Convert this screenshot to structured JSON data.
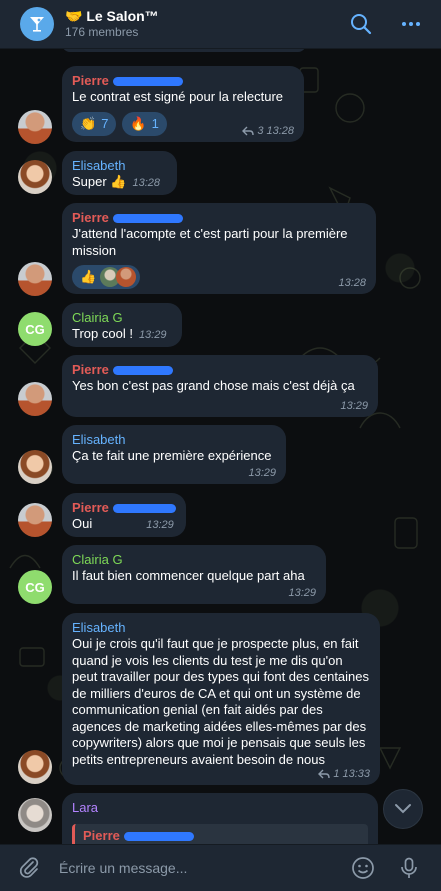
{
  "header": {
    "group_emoji": "🤝",
    "title": "Le Salon™",
    "subtitle": "176 membres",
    "icons": [
      "martini-icon",
      "search-icon",
      "more-icon"
    ]
  },
  "messages": [
    {
      "sender": "Pierre",
      "text": "Le contrat est signé pour la relecture",
      "time": "13:28",
      "replies": "3",
      "reactions": [
        {
          "emoji": "👏",
          "count": "7"
        },
        {
          "emoji": "🔥",
          "count": "1"
        }
      ]
    },
    {
      "sender": "Elisabeth",
      "text": "Super 👍",
      "time": "13:28"
    },
    {
      "sender": "Pierre",
      "text": "J'attend l'acompte et c'est parti pour la première mission",
      "time": "13:28",
      "reactions": [
        {
          "emoji": "👍",
          "count": ""
        }
      ]
    },
    {
      "sender": "Clairia G",
      "text": "Trop cool !",
      "time": "13:29"
    },
    {
      "sender": "Pierre",
      "text": "Yes bon c'est pas grand chose mais c'est déjà ça",
      "time": "13:29"
    },
    {
      "sender": "Elisabeth",
      "text": "Ça te fait une première expérience",
      "time": "13:29"
    },
    {
      "sender": "Pierre",
      "text": "Oui",
      "time": "13:29"
    },
    {
      "sender": "Clairia G",
      "text": "Il faut bien commencer quelque part aha",
      "time": "13:29"
    },
    {
      "sender": "Elisabeth",
      "text": "Oui je crois qu'il faut que je prospecte plus, en fait quand je vois les clients du test je me dis qu'on peut travailler pour des types qui font des centaines de milliers d'euros de CA et qui ont un système de communication genial (en fait aidés par des agences de marketing aidées elles-mêmes par des copywriters) alors que moi je pensais que seuls les petits entrepreneurs avaient besoin de nous",
      "time": "13:33",
      "replies": "1"
    },
    {
      "sender": "Lara",
      "reply_to": "Pierre"
    }
  ],
  "avatar_initials": "CG",
  "composer": {
    "placeholder": "Écrire un message..."
  },
  "colors": {
    "pierre": "#e25b57",
    "elisabeth": "#66b3ff",
    "clairia": "#7ed957",
    "lara": "#b383ff",
    "bubble": "#1e2733",
    "redaction": "#2f78ff"
  }
}
